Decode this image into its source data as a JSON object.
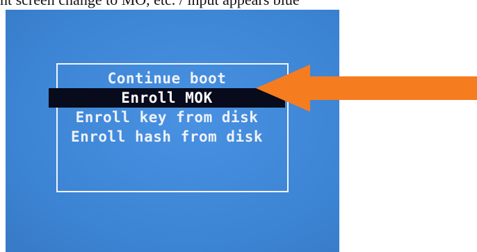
{
  "caption": {
    "text": "nt screen change to MO, etc. / input appears blue"
  },
  "boot_menu": {
    "items": [
      {
        "label": "Continue boot",
        "selected": false
      },
      {
        "label": "Enroll MOK",
        "selected": true
      },
      {
        "label": "Enroll key from disk",
        "selected": false
      },
      {
        "label": "Enroll hash from disk",
        "selected": false
      }
    ]
  },
  "annotation_arrow": {
    "color": "#f57c1f",
    "points_to": "Continue boot"
  },
  "colors": {
    "screen_background": "#3f8be0",
    "selected_background": "#070b1c",
    "menu_text": "#eef2f8",
    "border": "#f4f6fa"
  }
}
